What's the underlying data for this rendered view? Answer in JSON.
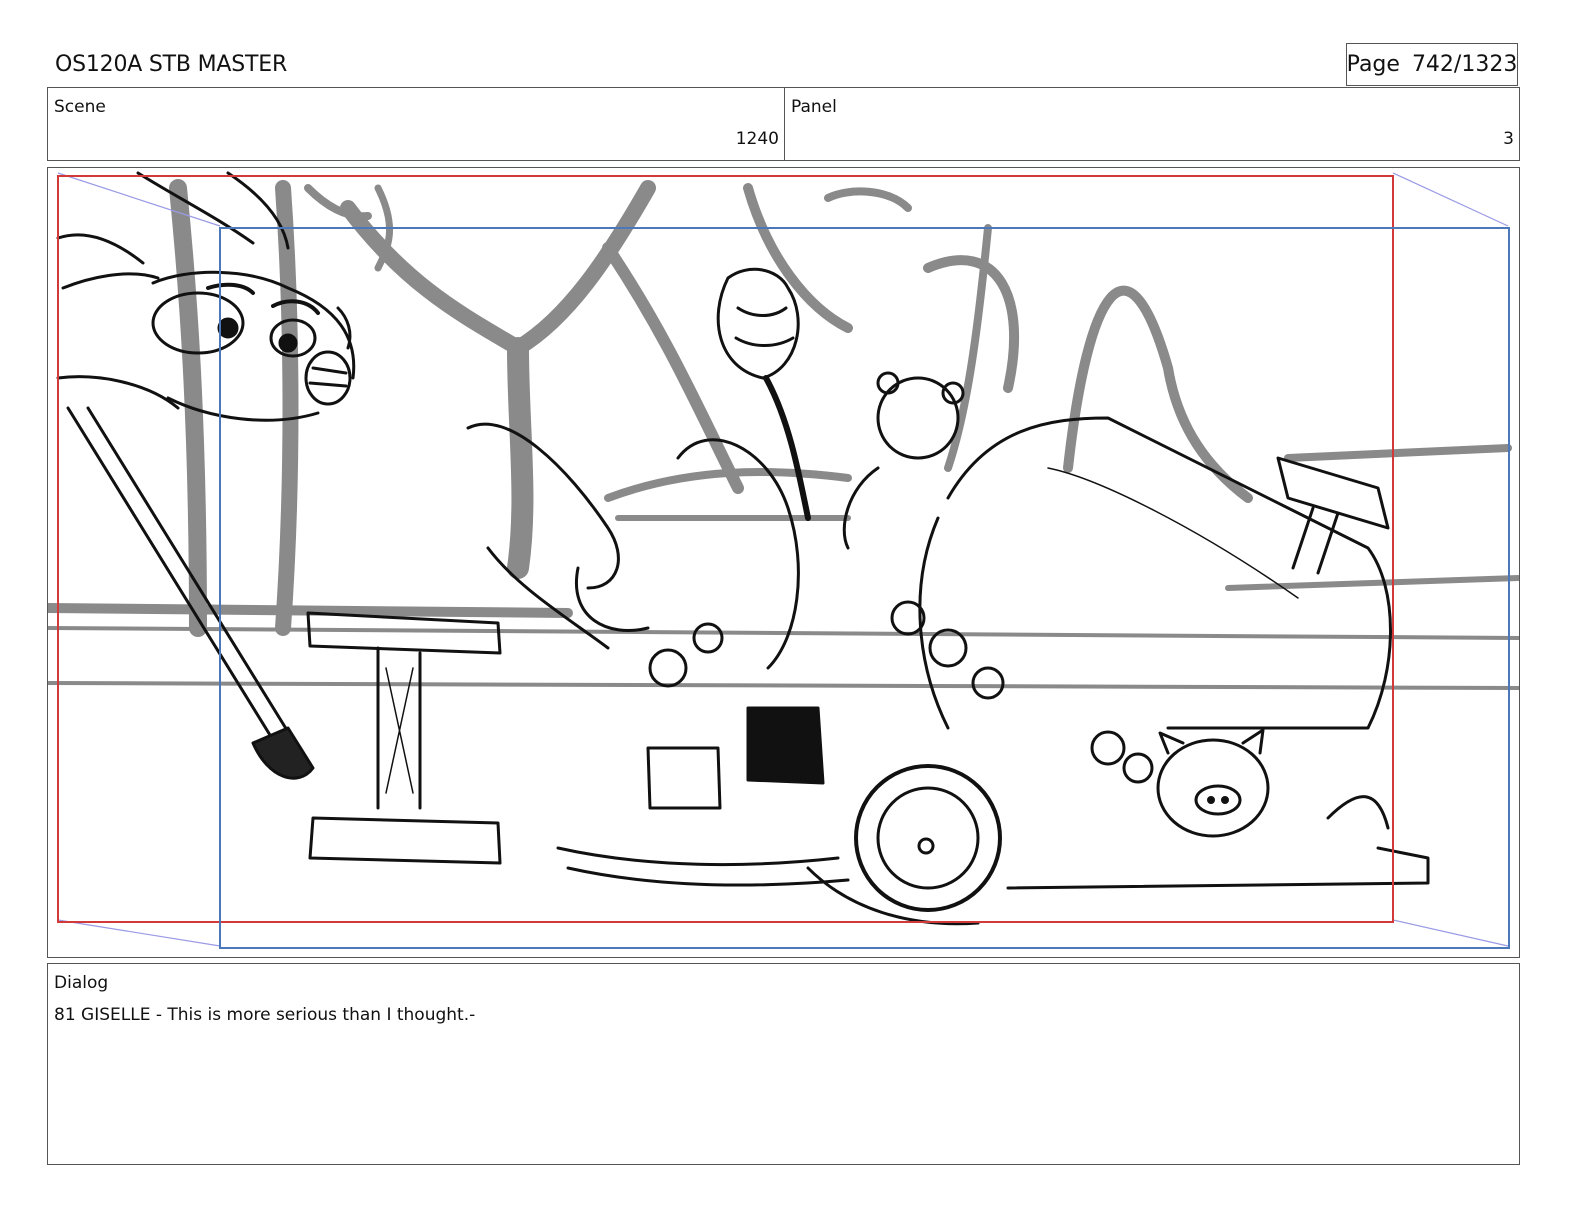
{
  "header": {
    "title": "OS120A STB MASTER",
    "page_label": "Page",
    "page_number": "742/1323"
  },
  "scene": {
    "label": "Scene",
    "value": "1240"
  },
  "panel": {
    "label": "Panel",
    "value": "3"
  },
  "frame": {
    "safe_frame_color": "#d23a3a",
    "camera_frame_color": "#4a78b8",
    "camera_move_guide_color": "#9a9ae6"
  },
  "dialog": {
    "label": "Dialog",
    "text": "81 GISELLE - This is more serious than I thought.-"
  }
}
